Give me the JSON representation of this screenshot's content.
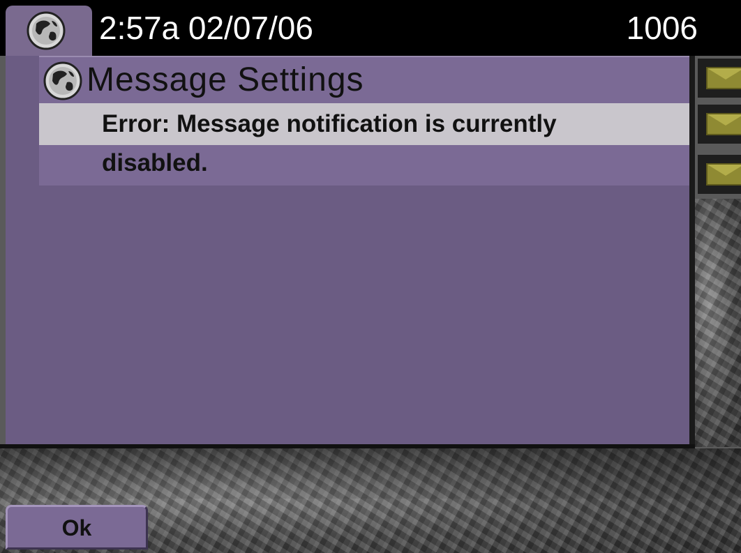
{
  "status_bar": {
    "icon": "globe-icon",
    "time_date": "2:57a 02/07/06",
    "extension": "1006"
  },
  "screen": {
    "icon": "globe-icon",
    "title": "Message Settings",
    "message_line_1": "Error: Message notification is currently",
    "message_line_2": "disabled."
  },
  "line_keys": [
    {
      "icon": "envelope-icon"
    },
    {
      "icon": "envelope-icon"
    },
    {
      "icon": "envelope-icon"
    }
  ],
  "softkeys": {
    "ok_label": "Ok"
  },
  "colors": {
    "panel": "#6b5c83",
    "title_bar": "#7b6a95",
    "highlight_row": "#c9c6cc",
    "status_bar": "#000000",
    "envelope": "#8f8a33"
  }
}
